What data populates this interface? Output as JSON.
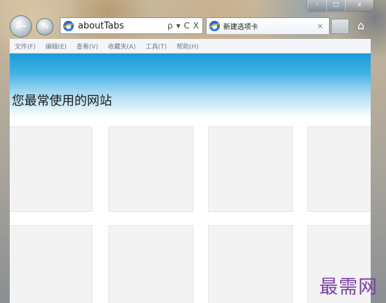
{
  "window": {
    "caption_buttons": [
      "-",
      "□",
      "x"
    ]
  },
  "navigation": {
    "back_icon": "back-arrow-icon",
    "forward_icon": "forward-arrow-icon",
    "back_glyph": "←",
    "forward_glyph": "→"
  },
  "address_bar": {
    "value": "aboutTabs",
    "search_glyph": "ρ",
    "dropdown_glyph": "▾",
    "refresh_glyph": "C",
    "stop_glyph": "X"
  },
  "tabs": [
    {
      "label": "新建选项卡",
      "close_glyph": "×"
    }
  ],
  "home": {
    "glyph": "⌂"
  },
  "menu": {
    "items": [
      "文件(F)",
      "编辑(E)",
      "查看(V)",
      "收藏夹(A)",
      "工具(T)",
      "帮助(H)"
    ]
  },
  "page": {
    "heading": "您最常使用的网站",
    "tile_count": 8
  },
  "watermark": {
    "text": "最需网",
    "color": "#7b3fa6"
  },
  "colors": {
    "banner_top": "#1b9ad9",
    "tile_background": "#f3f3f3"
  }
}
